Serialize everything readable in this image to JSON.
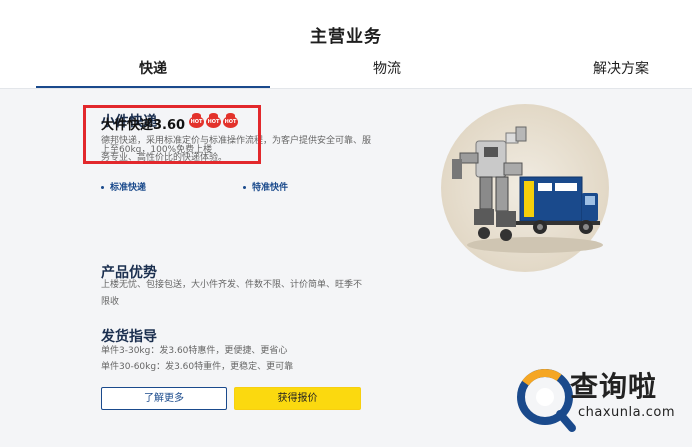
{
  "section_title": "主营业务",
  "tabs": [
    {
      "label": "快递",
      "active": true
    },
    {
      "label": "物流",
      "active": false
    },
    {
      "label": "解决方案",
      "active": false
    }
  ],
  "small_parcel": {
    "title": "小件快递",
    "description": "德邦快递，采用标准定价与标准操作流程，为客户提供安全可靠、服务专业、高性价比的快递体验。",
    "bullets": [
      "标准快递",
      "特准快件"
    ]
  },
  "large_parcel": {
    "title": "大件快递3.60",
    "badges": [
      "HOT",
      "HOT",
      "HOT"
    ],
    "subtitle": "上至60kg，100%免费上楼"
  },
  "advantages": {
    "title": "产品优势",
    "text": "上楼无忧、包接包送，大小件齐发、件数不限、计价简单、旺季不限收"
  },
  "shipping_guide": {
    "title": "发货指导",
    "lines": [
      "单件3-30kg：发3.60特惠件，更便捷、更省心",
      "单件30-60kg：发3.60特重件，更稳定、更可靠"
    ]
  },
  "buttons": {
    "learn_more": "了解更多",
    "get_quote": "获得报价"
  },
  "watermark": {
    "brand": "查询啦",
    "url": "chaxunla.com"
  },
  "colors": {
    "brand_blue": "#1a4a8c",
    "accent_yellow": "#fbd90f",
    "highlight_red": "#e2282c"
  }
}
